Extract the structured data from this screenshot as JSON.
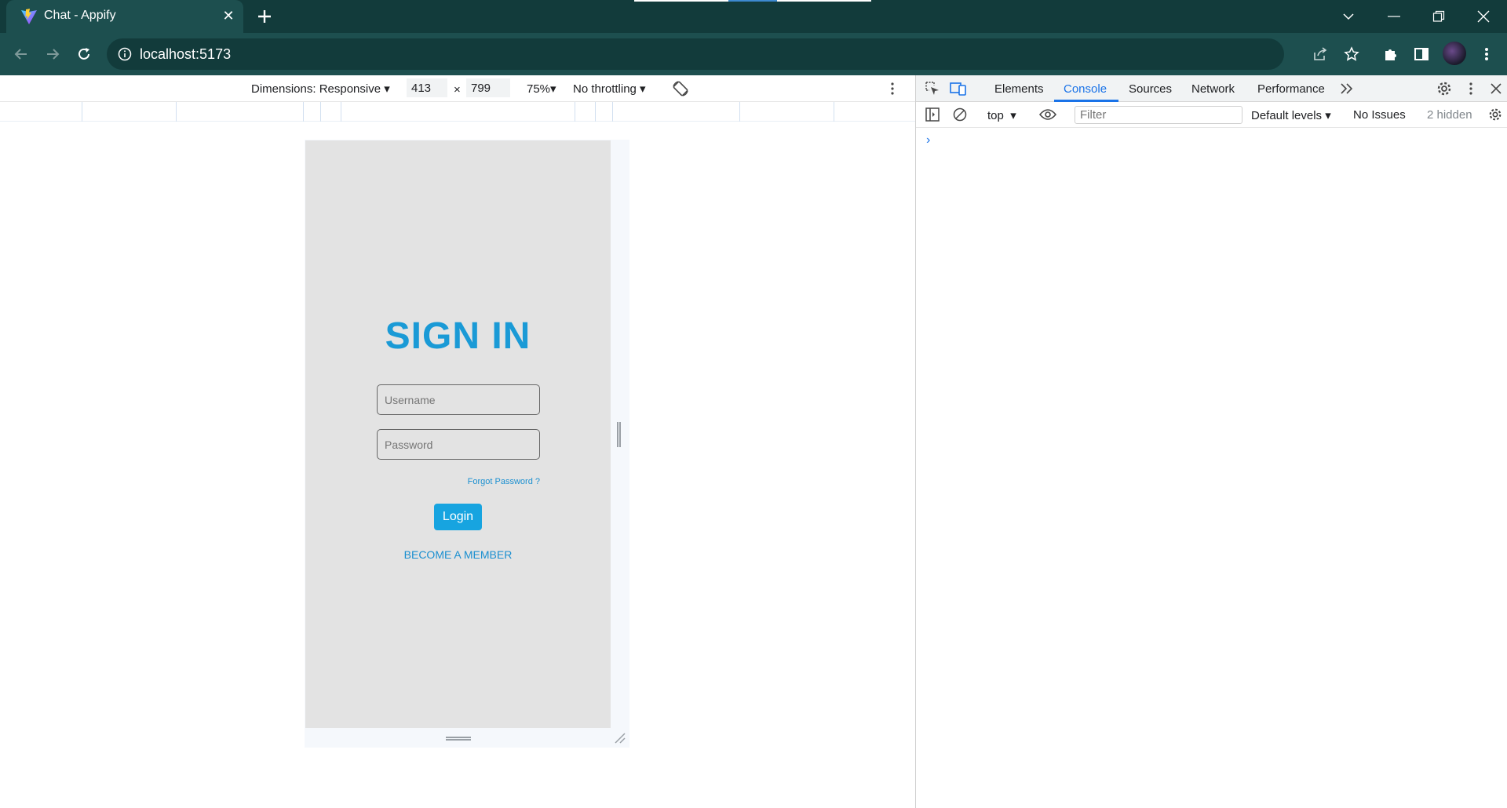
{
  "browser": {
    "tab_title": "Chat - Appify",
    "url": "localhost:5173"
  },
  "device_toolbar": {
    "dimensions_label": "Dimensions: Responsive",
    "width": "413",
    "times": "×",
    "height": "799",
    "zoom": "75%",
    "throttling": "No throttling"
  },
  "app": {
    "title": "SIGN IN",
    "username_placeholder": "Username",
    "password_placeholder": "Password",
    "forgot_password": "Forgot Password ?",
    "login_label": "Login",
    "become_member": "BECOME A MEMBER",
    "colors": {
      "accent": "#1a9ad6",
      "button": "#17a4e0",
      "background": "#e3e3e3"
    }
  },
  "devtools": {
    "tabs": [
      "Elements",
      "Console",
      "Sources",
      "Network",
      "Performance"
    ],
    "active_tab": "Console",
    "context": "top",
    "filter_placeholder": "Filter",
    "levels": "Default levels",
    "issues": "No Issues",
    "hidden": "2 hidden",
    "prompt": "›"
  },
  "icons": [
    "vite-favicon",
    "close-icon",
    "plus-icon",
    "chevron-down-icon",
    "minimize-icon",
    "restore-icon",
    "back-icon",
    "forward-icon",
    "reload-icon",
    "info-icon",
    "share-icon",
    "star-icon",
    "extensions-icon",
    "sidepanel-icon",
    "kebab-icon",
    "rotate-icon",
    "inspect-icon",
    "device-icon",
    "more-tabs-icon",
    "gear-icon",
    "sidebar-toggle-icon",
    "clear-icon",
    "eye-icon"
  ]
}
